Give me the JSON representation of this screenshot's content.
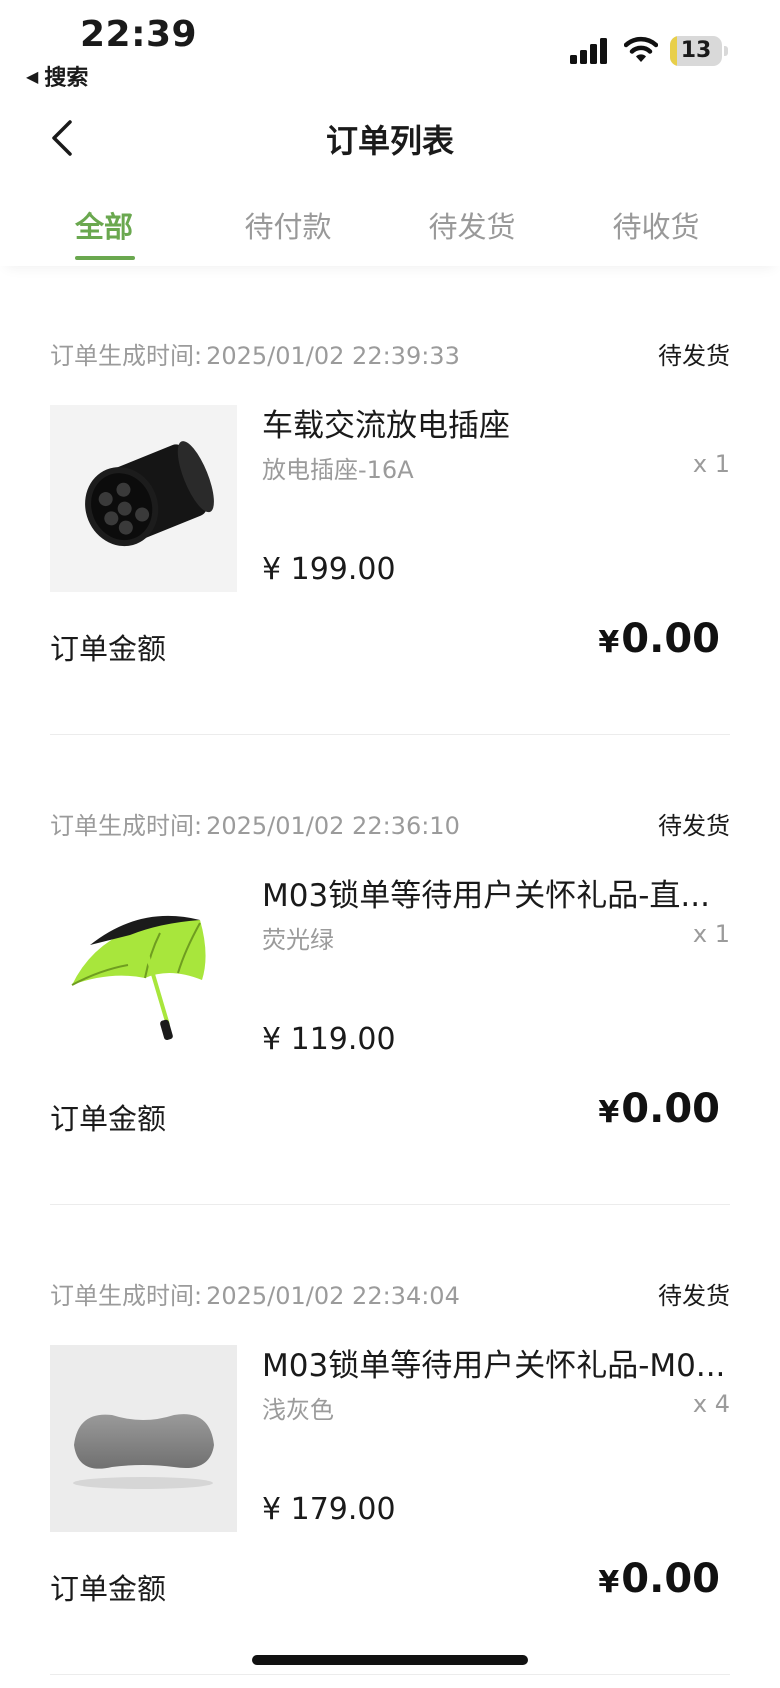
{
  "status_bar": {
    "time": "22:39",
    "back_app": "搜索",
    "battery_level": "13"
  },
  "header": {
    "title": "订单列表"
  },
  "tabs": [
    {
      "label": "全部",
      "active": true
    },
    {
      "label": "待付款",
      "active": false
    },
    {
      "label": "待发货",
      "active": false
    },
    {
      "label": "待收货",
      "active": false
    }
  ],
  "orders": [
    {
      "time_label": "订单生成时间:",
      "time": "2025/01/02 22:39:33",
      "status": "待发货",
      "product_name": "车载交流放电插座",
      "spec": "放电插座-16A",
      "qty": "x 1",
      "price": "¥ 199.00",
      "total_label": "订单金额",
      "total_currency": "¥",
      "total_amount": "0.00",
      "thumb_icon": "discharge-socket-image"
    },
    {
      "time_label": "订单生成时间:",
      "time": "2025/01/02 22:36:10",
      "status": "待发货",
      "product_name": "M03锁单等待用户关怀礼品-直...",
      "spec": "荧光绿",
      "qty": "x 1",
      "price": "¥ 119.00",
      "total_label": "订单金额",
      "total_currency": "¥",
      "total_amount": "0.00",
      "thumb_icon": "umbrella-image"
    },
    {
      "time_label": "订单生成时间:",
      "time": "2025/01/02 22:34:04",
      "status": "待发货",
      "product_name": "M03锁单等待用户关怀礼品-M0...",
      "spec": "浅灰色",
      "qty": "x 4",
      "price": "¥ 179.00",
      "total_label": "订单金额",
      "total_currency": "¥",
      "total_amount": "0.00",
      "thumb_icon": "headrest-pillow-image"
    }
  ],
  "colors": {
    "accent": "#6aa84f",
    "muted_text": "#9b9b9b",
    "battery": "#e8cf4a"
  }
}
